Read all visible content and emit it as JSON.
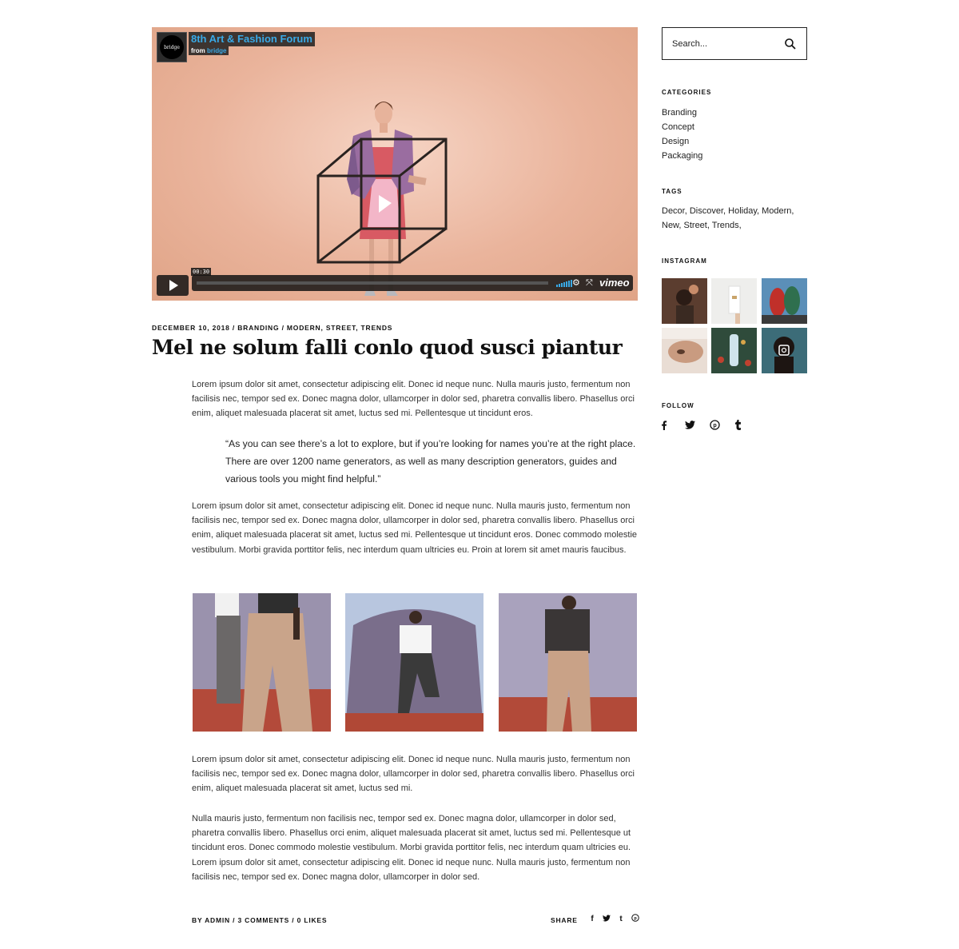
{
  "video": {
    "channel_logo": "bridge",
    "title": "8th Art & Fashion Forum",
    "from_label": "from",
    "from_source": "bridge",
    "duration": "00:30",
    "progress": 0.0,
    "brand": "vimeo",
    "icons": [
      "play-icon",
      "volume-icon",
      "settings-icon",
      "fullscreen-icon",
      "vimeo-logo"
    ]
  },
  "post": {
    "meta": {
      "date": "DECEMBER 10, 2018",
      "sep": " / ",
      "category": "BRANDING",
      "tags": "MODERN, STREET, TRENDS"
    },
    "title": "Mel ne solum falli conlo quod susci piantur",
    "paragraph1": "Lorem ipsum dolor sit amet, consectetur adipiscing elit. Donec id neque nunc. Nulla mauris justo, fermentum non facilisis nec, tempor sed ex. Donec magna dolor, ullamcorper in dolor sed, pharetra convallis libero. Phasellus orci enim, aliquet malesuada placerat sit amet, luctus sed mi. Pellentesque ut tincidunt eros.",
    "quote": "“As you can see there’s a lot to explore, but if you’re looking for names you’re at the right place. There are over 1200 name generators, as well as many description generators, guides and various tools you might find helpful.”",
    "paragraph2": "Lorem ipsum dolor sit amet, consectetur adipiscing elit. Donec id neque nunc. Nulla mauris justo, fermentum non facilisis nec, tempor sed ex. Donec magna dolor, ullamcorper in dolor sed, pharetra convallis libero. Phasellus orci enim, aliquet malesuada placerat sit amet, luctus sed mi. Pellentesque ut tincidunt eros. Donec commodo molestie vestibulum. Morbi gravida porttitor felis, nec interdum quam ultricies eu. Proin at lorem sit amet mauris faucibus.",
    "paragraph3": "Lorem ipsum dolor sit amet, consectetur adipiscing elit. Donec id neque nunc. Nulla mauris justo, fermentum non facilisis nec, tempor sed ex. Donec magna dolor, ullamcorper in dolor sed, pharetra convallis libero. Phasellus orci enim, aliquet malesuada placerat sit amet, luctus sed mi.",
    "paragraph4": "Nulla mauris justo, fermentum non facilisis nec, tempor sed ex. Donec magna dolor, ullamcorper in dolor sed, pharetra convallis libero. Phasellus orci enim, aliquet malesuada placerat sit amet, luctus sed mi. Pellentesque ut tincidunt eros. Donec commodo molestie vestibulum. Morbi gravida porttitor felis, nec interdum quam ultricies eu. Lorem ipsum dolor sit amet, consectetur adipiscing elit. Donec id neque nunc. Nulla mauris justo, fermentum non facilisis nec, tempor sed ex. Donec magna dolor, ullamcorper in dolor sed.",
    "footer": {
      "author": "BY ADMIN",
      "sep": " / ",
      "comments": "3 COMMENTS",
      "likes": "0 LIKES",
      "share_label": "SHARE",
      "share_icons": [
        "f",
        "twitter-icon",
        "t",
        "pinterest-icon"
      ]
    }
  },
  "sidebar": {
    "search_placeholder": "Search...",
    "categories_title": "CATEGORIES",
    "categories": [
      "Branding",
      "Concept",
      "Design",
      "Packaging"
    ],
    "tags_title": "TAGS",
    "tags": "Decor, Discover, Holiday, Modern, New, Street, Trends,",
    "instagram_title": "INSTAGRAM",
    "follow_title": "FOLLOW",
    "follow_icons": [
      "facebook-icon",
      "twitter-icon",
      "pinterest-icon",
      "tumblr-icon"
    ]
  },
  "colors": {
    "accent_blue": "#39a9e6",
    "text": "#222222",
    "video_bg": "#eab49c"
  }
}
